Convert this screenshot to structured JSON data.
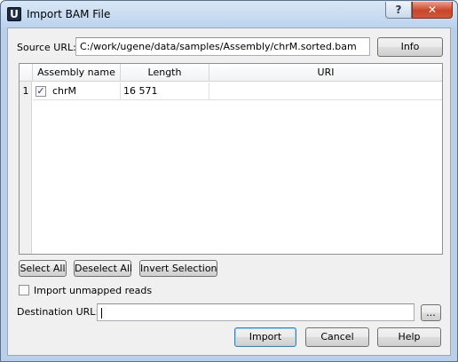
{
  "window": {
    "title": "Import BAM File",
    "app_icon_letter": "U",
    "help_glyph": "?",
    "close_glyph": "✕"
  },
  "source": {
    "label": "Source URL:",
    "value": "C:/work/ugene/data/samples/Assembly/chrM.sorted.bam",
    "info_label": "Info"
  },
  "table": {
    "columns": [
      "Assembly name",
      "Length",
      "URI"
    ],
    "rows": [
      {
        "index": "1",
        "checked": true,
        "check_glyph": "✓",
        "name": "chrM",
        "length": "16 571",
        "uri": ""
      }
    ]
  },
  "selection_buttons": {
    "select_all": "Select All",
    "deselect_all": "Deselect All",
    "invert_selection": "Invert Selection"
  },
  "unmapped": {
    "label": "Import unmapped reads",
    "checked": false
  },
  "destination": {
    "label": "Destination URL:",
    "value": "",
    "browse_label": "..."
  },
  "footer": {
    "import_label": "Import",
    "cancel_label": "Cancel",
    "help_label": "Help"
  }
}
